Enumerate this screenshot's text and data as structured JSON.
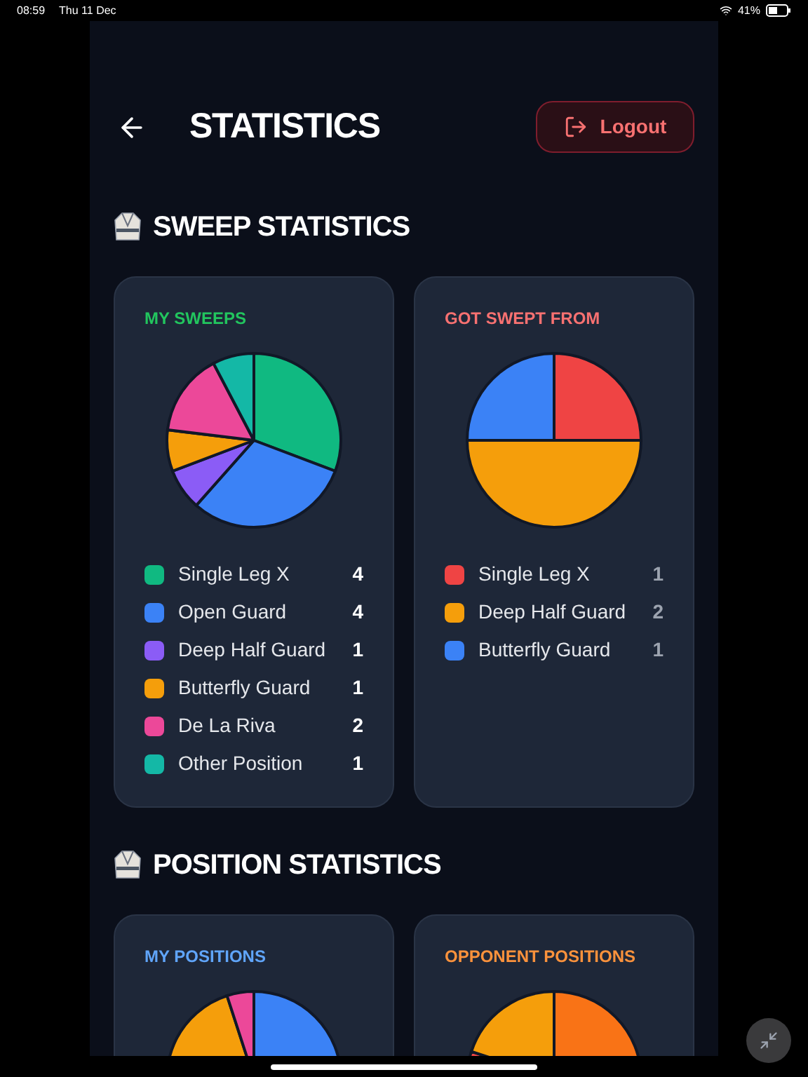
{
  "status_bar": {
    "time": "08:59",
    "date": "Thu 11 Dec",
    "battery": "41%"
  },
  "header": {
    "title": "STATISTICS",
    "logout": "Logout"
  },
  "sections": [
    {
      "title": "SWEEP STATISTICS",
      "cards": [
        {
          "title": "MY SWEEPS",
          "color": "#22c55e",
          "chart_data": {
            "type": "pie",
            "categories": [
              "Single Leg X",
              "Open Guard",
              "Deep Half Guard",
              "Butterfly Guard",
              "De La Riva",
              "Other Position"
            ],
            "values": [
              4,
              4,
              1,
              1,
              2,
              1
            ],
            "legend": "bottom",
            "value_labels": [
              "4",
              "4",
              "1",
              "1",
              "2",
              "1"
            ],
            "colors": [
              "#10b981",
              "#3b82f6",
              "#8b5cf6",
              "#f59e0b",
              "#ec4899",
              "#14b8a6"
            ]
          }
        },
        {
          "title": "GOT SWEPT FROM",
          "color": "#f87171",
          "chart_data": {
            "type": "pie",
            "categories": [
              "Single Leg X",
              "Deep Half Guard",
              "Butterfly Guard"
            ],
            "values": [
              1,
              2,
              1
            ],
            "legend": "bottom",
            "value_labels": [
              "1",
              "2",
              "1"
            ],
            "colors": [
              "#ef4444",
              "#f59e0b",
              "#3b82f6"
            ]
          }
        }
      ]
    },
    {
      "title": "POSITION STATISTICS",
      "cards": [
        {
          "title": "MY POSITIONS",
          "color": "#60a5fa",
          "kind": "partial"
        },
        {
          "title": "OPPONENT POSITIONS",
          "color": "#fb923c",
          "kind": "partial"
        }
      ]
    }
  ]
}
